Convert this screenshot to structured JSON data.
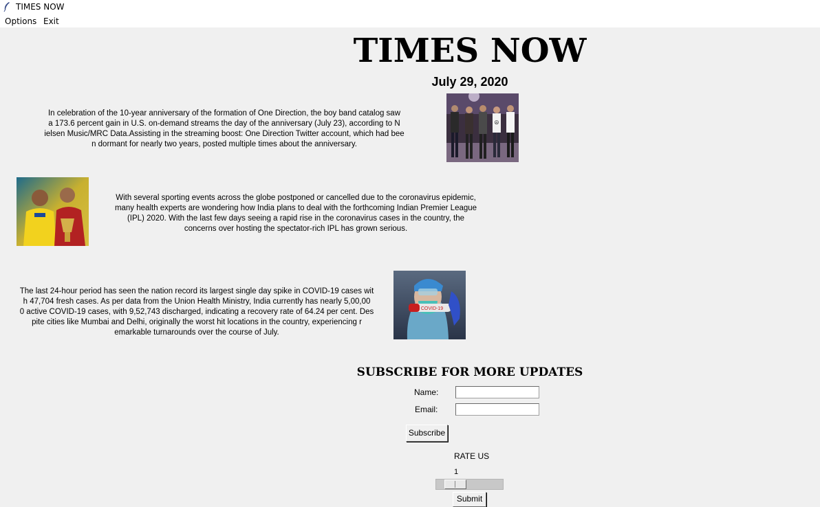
{
  "window": {
    "title": "TIMES NOW"
  },
  "menu": [
    {
      "label": "Options"
    },
    {
      "label": "Exit"
    }
  ],
  "masthead": {
    "title": "TIMES NOW",
    "date": "July 29, 2020"
  },
  "stories": [
    {
      "lines": [
        "In celebration of the 10-year anniversary of the formation of One Direction, the boy band catalog saw",
        "a 173.6 percent gain in U.S. on-demand streams the day of the anniversary (July 23), according to N",
        "ielsen Music/MRC Data.Assisting in the streaming boost: One Direction Twitter account, which had bee",
        "n dormant for nearly two years, posted multiple times about the anniversary."
      ],
      "image": "one-direction-photo"
    },
    {
      "lines": [
        "With several sporting events across the globe postponed or cancelled due to the coronavirus epidemic,",
        "many health experts are wondering how India plans to deal with the forthcoming Indian Premier League",
        "(IPL) 2020. With the last few days seeing a rapid rise in the coronavirus cases in the country, the",
        "concerns over hosting the spectator-rich IPL has grown serious."
      ],
      "image": "ipl-cricketers-photo"
    },
    {
      "lines": [
        "The last 24-hour period has seen the nation record its largest single day spike in COVID-19 cases wit",
        "h 47,704 fresh cases. As per data from the Union Health Ministry, India currently has nearly 5,00,00",
        "0 active COVID-19 cases, with 9,52,743 discharged, indicating a recovery rate of 64.24 per cent. Des",
        "pite cities like Mumbai and Delhi, originally the worst hit locations in the country, experiencing r",
        "emarkable turnarounds over the course of July."
      ],
      "image": "covid-test-photo",
      "image_label": "COVID-19"
    }
  ],
  "subscribe": {
    "title": "SUBSCRIBE FOR MORE UPDATES",
    "name_label": "Name:",
    "email_label": "Email:",
    "name_value": "",
    "email_value": "",
    "button_label": "Subscribe"
  },
  "rating": {
    "label": "RATE US",
    "value": "1",
    "min": 1,
    "max": 5,
    "submit_label": "Submit"
  }
}
